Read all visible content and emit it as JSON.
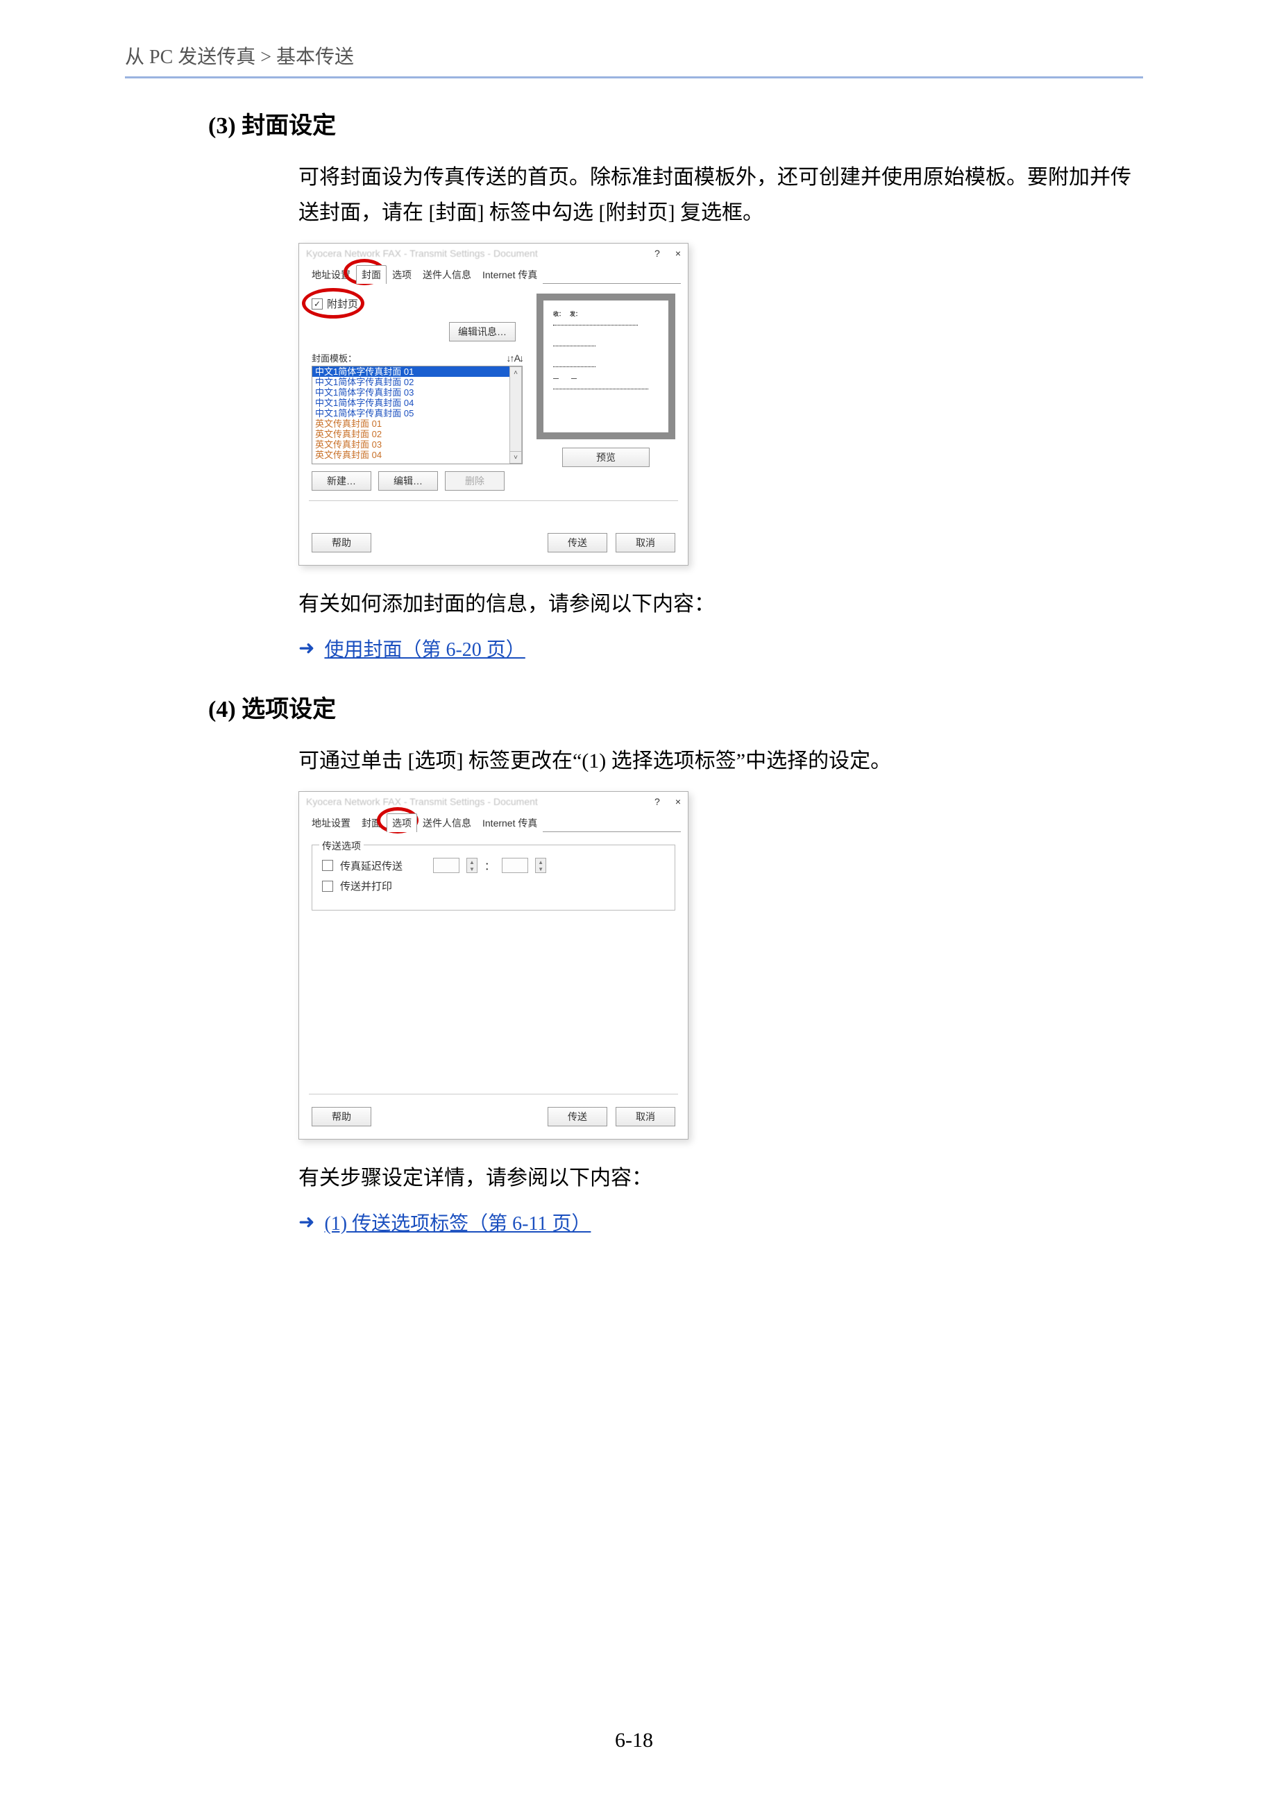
{
  "breadcrumb": "从 PC 发送传真 > 基本传送",
  "page_number": "6-18",
  "section3": {
    "title": "(3) 封面设定",
    "p1": "可将封面设为传真传送的首页。除标准封面模板外，还可创建并使用原始模板。要附加并传送封面，请在 [封面] 标签中勾选 [附封页] 复选框。",
    "ref_intro": "有关如何添加封面的信息，请参阅以下内容：",
    "ref_link": "使用封面（第 6-20 页）"
  },
  "section4": {
    "title": "(4) 选项设定",
    "p1": "可通过单击 [选项] 标签更改在“(1) 选择选项标签”中选择的设定。",
    "ref_intro": "有关步骤设定详情，请参阅以下内容：",
    "ref_link": "(1) 传送选项标签（第 6-11 页）"
  },
  "dialog1": {
    "title": "Kyocera Network FAX - Transmit Settings - Document",
    "help": "?",
    "close": "×",
    "tabs": [
      "地址设置",
      "封面",
      "选项",
      "送件人信息",
      "Internet 传真"
    ],
    "attach_cb": "附封页",
    "edit_info_btn": "编辑讯息…",
    "template_label": "封面模板：",
    "templates": [
      "中文1简体字传真封面 01",
      "中文1简体字传真封面 02",
      "中文1简体字传真封面 03",
      "中文1简体字传真封面 04",
      "中文1简体字传真封面 05",
      "英文传真封面 01",
      "英文传真封面 02",
      "英文传真封面 03",
      "英文传真封面 04"
    ],
    "new_btn": "新建…",
    "edit_btn": "编辑…",
    "delete_btn": "删除",
    "preview_btn": "预览",
    "help_btn": "帮助",
    "send_btn": "传送",
    "cancel_btn": "取消",
    "sort_icons": "↓↑ A↓"
  },
  "dialog2": {
    "title": "Kyocera Network FAX - Transmit Settings - Document",
    "help": "?",
    "close": "×",
    "tabs": [
      "地址设置",
      "封面",
      "选项",
      "送件人信息",
      "Internet 传真"
    ],
    "fieldset_label": "传送选项",
    "delay_cb": "传真延迟传送",
    "colon": "：",
    "print_cb": "传送并打印",
    "help_btn": "帮助",
    "send_btn": "传送",
    "cancel_btn": "取消"
  }
}
